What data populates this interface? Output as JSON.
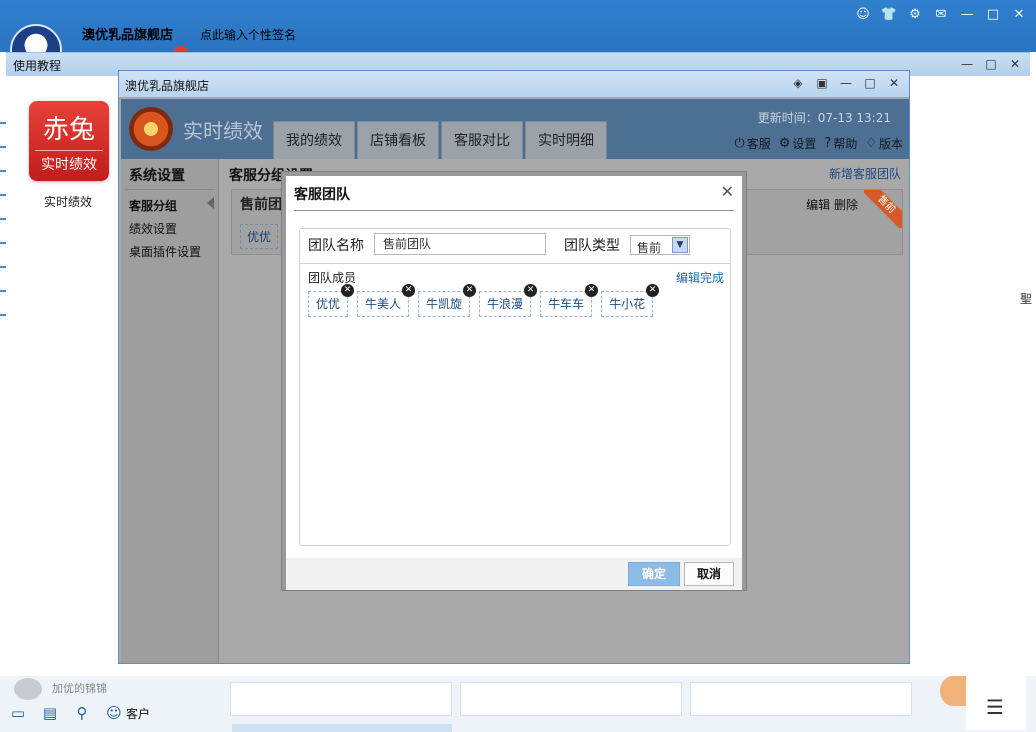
{
  "im": {
    "shop_name": "澳优乳品旗舰店",
    "signature": "点此输入个性签名",
    "contact_name": "加优的锦锦",
    "dock_customer_label": "客户"
  },
  "tutorial": {
    "title": "使用教程"
  },
  "brand": {
    "line1": "赤兔",
    "line2": "实时绩效",
    "caption": "实时绩效"
  },
  "right_edge_char": "聖",
  "plugin": {
    "title": "澳优乳品旗舰店",
    "app_title": "实时绩效",
    "tabs": [
      "我的绩效",
      "店铺看板",
      "客服对比",
      "实时明细"
    ],
    "update_time": "更新时间：07-13 13:21",
    "header_links": [
      {
        "label": "客服",
        "icon": "power-icon"
      },
      {
        "label": "设置",
        "icon": "gear-icon"
      },
      {
        "label": "帮助",
        "icon": "help-icon"
      },
      {
        "label": "版本",
        "icon": "bulb-icon"
      }
    ],
    "side": {
      "heading": "系统设置",
      "items": [
        "客服分组",
        "绩效设置",
        "桌面插件设置"
      ]
    },
    "main": {
      "title": "客服分组设置",
      "new_team": "新增客服团队",
      "card": {
        "name": "售前团",
        "edit": "编辑",
        "delete": "删除",
        "ribbon": "售前",
        "member": "优优"
      }
    }
  },
  "modal": {
    "title": "客服团队",
    "name_label": "团队名称",
    "name_value": "售前团队",
    "type_label": "团队类型",
    "type_value": "售前",
    "members_label": "团队成员",
    "edit_done": "编辑完成",
    "members": [
      "优优",
      "牛美人",
      "牛凯旋",
      "牛浪漫",
      "牛车车",
      "牛小花"
    ],
    "ok": "确定",
    "cancel": "取消"
  }
}
